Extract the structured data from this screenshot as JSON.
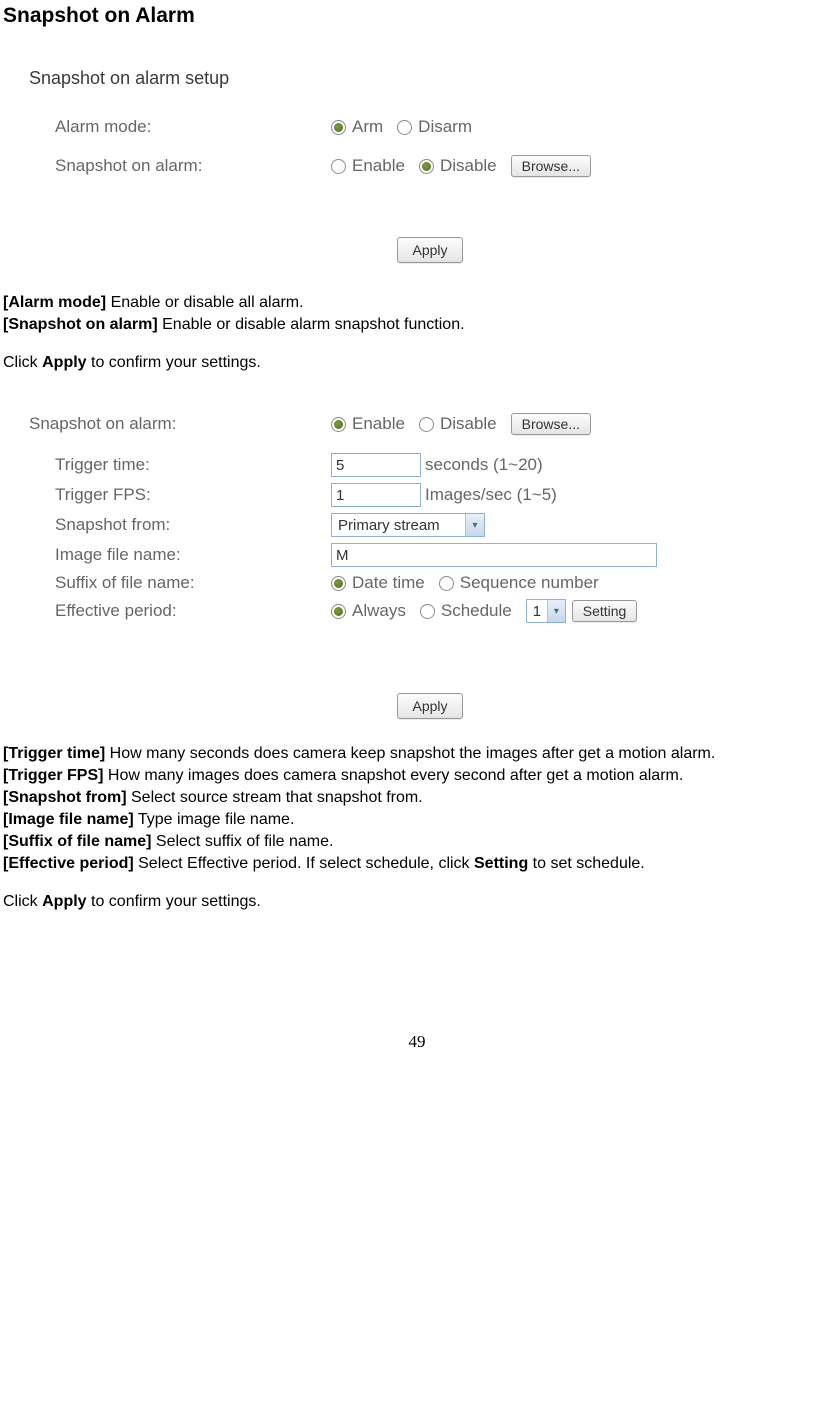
{
  "title": "Snapshot on Alarm",
  "section1": {
    "header": "Snapshot on alarm setup",
    "rows": {
      "alarm_mode": {
        "label": "Alarm mode:",
        "opt1": "Arm",
        "opt2": "Disarm"
      },
      "snapshot": {
        "label": "Snapshot on alarm:",
        "opt1": "Enable",
        "opt2": "Disable",
        "browse": "Browse..."
      }
    },
    "apply": "Apply"
  },
  "desc1": {
    "l1a": "[Alarm mode]",
    "l1b": " Enable or disable all alarm.",
    "l2a": "[Snapshot on alarm]",
    "l2b": " Enable or disable alarm snapshot function.",
    "l3a": "Click ",
    "l3b": "Apply",
    "l3c": " to confirm your settings."
  },
  "section2": {
    "rows": {
      "snapshot": {
        "label": "Snapshot on alarm:",
        "opt1": "Enable",
        "opt2": "Disable",
        "browse": "Browse..."
      },
      "trigger_time": {
        "label": "Trigger time:",
        "value": "5",
        "hint": "seconds (1~20)"
      },
      "trigger_fps": {
        "label": "Trigger FPS:",
        "value": "1",
        "hint": "Images/sec (1~5)"
      },
      "snapshot_from": {
        "label": "Snapshot from:",
        "value": "Primary stream"
      },
      "file_name": {
        "label": "Image file name:",
        "value": "M"
      },
      "suffix": {
        "label": "Suffix of file name:",
        "opt1": "Date time",
        "opt2": "Sequence number"
      },
      "effective": {
        "label": "Effective period:",
        "opt1": "Always",
        "opt2": "Schedule",
        "sel": "1",
        "btn": "Setting"
      }
    },
    "apply": "Apply"
  },
  "desc2": {
    "l1a": "[Trigger time]",
    "l1b": " How many seconds does camera keep snapshot the images after get a motion alarm.",
    "l2a": "[Trigger FPS]",
    "l2b": " How many images does camera snapshot every second after get a motion alarm.",
    "l3a": "[Snapshot from]",
    "l3b": " Select source stream that snapshot from.",
    "l4a": "[Image file name]",
    "l4b": " Type image file name.",
    "l5a": "[Suffix of file name]",
    "l5b": " Select suffix of file name.",
    "l6a": "[Effective period]",
    "l6b": " Select Effective period. If select schedule, click ",
    "l6c": "Setting",
    "l6d": " to set schedule.",
    "l7a": "Click ",
    "l7b": "Apply",
    "l7c": " to confirm your settings."
  },
  "pagenum": "49"
}
